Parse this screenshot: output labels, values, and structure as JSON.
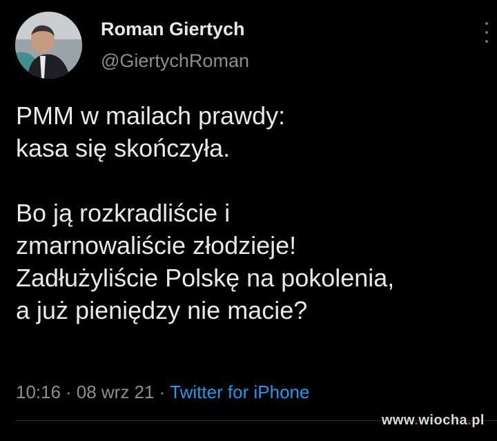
{
  "author": {
    "display_name": "Roman Giertych",
    "handle": "@GiertychRoman",
    "avatar_icon": "profile-photo"
  },
  "tweet": {
    "lines": [
      "PMM w mailach prawdy:",
      "kasa się skończyła.",
      "",
      "Bo ją rozkradliście i",
      "zmarnowaliście złodzieje!",
      "Zadłużyliście Polskę na pokolenia,",
      "a już pieniędzy nie macie?"
    ]
  },
  "meta": {
    "time": "10:16",
    "separator": "·",
    "date": "08 wrz 21",
    "source": "Twitter for iPhone"
  },
  "more_icon": "vertical-ellipsis-icon",
  "watermark": {
    "prefix": "www",
    "dot1": ".",
    "name": "wiocha",
    "dot2": ".",
    "tld": "pl"
  },
  "colors": {
    "background": "#000000",
    "text": "#e7e9ea",
    "secondary": "#8b8f94",
    "link": "#1d9bf0"
  }
}
